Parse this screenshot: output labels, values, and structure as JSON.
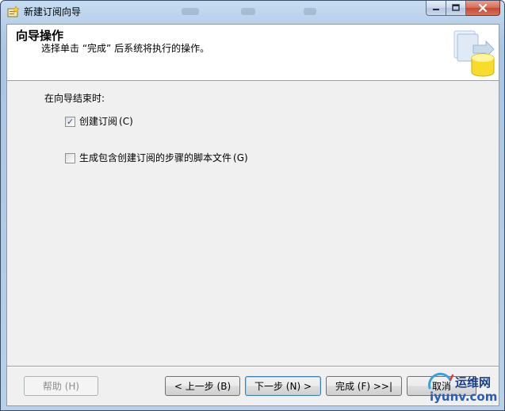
{
  "window": {
    "title": "新建订阅向导",
    "blur_tabs": [
      "",
      "",
      ""
    ]
  },
  "header": {
    "title": "向导操作",
    "subtitle": "选择单击 “完成” 后系统将执行的操作。",
    "graphic_icon": "wizard-database-icon"
  },
  "options": {
    "section_label": "在向导结束时:",
    "items": [
      {
        "label": "创建订阅",
        "accel": "(C)",
        "checked": true
      },
      {
        "label": "生成包含创建订阅的步骤的脚本文件",
        "accel": "(G)",
        "checked": false
      }
    ]
  },
  "buttons": {
    "help": "帮助 (H)",
    "back": "< 上一步 (B)",
    "next": "下一步 (N) >",
    "finish": "完成 (F) >>|",
    "cancel": "取消"
  },
  "watermark": {
    "cn": "运维网",
    "en": "iyunv.com"
  },
  "colors": {
    "titlebar": "#b7cfe8",
    "client": "#f0f0f0",
    "close": "#c44a33",
    "header_bg": "#ffffff"
  }
}
